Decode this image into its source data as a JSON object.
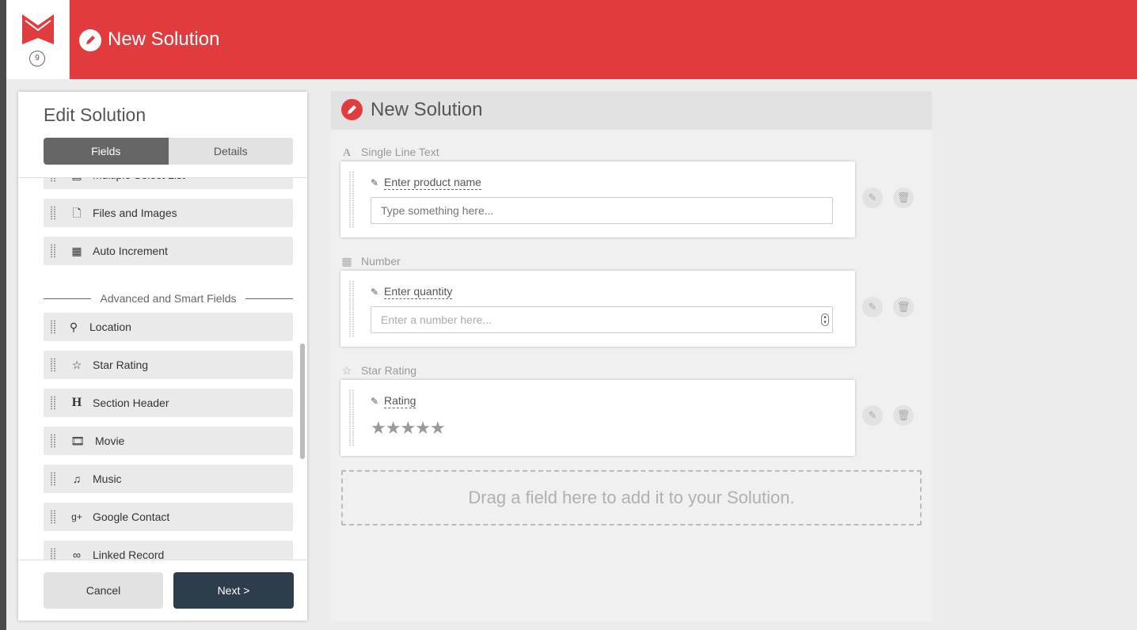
{
  "app": {
    "counter": "9",
    "header_title": "New Solution"
  },
  "sidebar": {
    "title": "Edit Solution",
    "tabs": [
      {
        "label": "Fields",
        "active": true
      },
      {
        "label": "Details",
        "active": false
      }
    ],
    "partial_item_label": "Multiple Select List",
    "basic_items": [
      {
        "label": "Files and Images",
        "icon": "file-icon"
      },
      {
        "label": "Auto Increment",
        "icon": "calculator-icon"
      }
    ],
    "advanced_section_title": "Advanced and Smart Fields",
    "advanced_items": [
      {
        "label": "Location",
        "icon": "map-marker-icon"
      },
      {
        "label": "Star Rating",
        "icon": "star-icon"
      },
      {
        "label": "Section Header",
        "icon": "header-icon"
      },
      {
        "label": "Movie",
        "icon": "film-icon"
      },
      {
        "label": "Music",
        "icon": "music-icon"
      },
      {
        "label": "Google Contact",
        "icon": "google-plus-icon"
      },
      {
        "label": "Linked Record",
        "icon": "link-icon"
      }
    ],
    "cancel_label": "Cancel",
    "next_label": "Next >"
  },
  "canvas": {
    "title": "New Solution",
    "fields": [
      {
        "type_label": "Single Line Text",
        "type_icon": "text-icon",
        "label": "Enter product name",
        "placeholder": "Type something here..."
      },
      {
        "type_label": "Number",
        "type_icon": "calculator-icon",
        "label": "Enter quantity",
        "placeholder": "Enter a number here..."
      },
      {
        "type_label": "Star Rating",
        "type_icon": "star-icon",
        "label": "Rating",
        "stars": 5
      }
    ],
    "dropzone_text": "Drag a field here to add it to your Solution."
  },
  "colors": {
    "brand_red": "#e03c3e",
    "dark_button": "#2e3d4b"
  }
}
